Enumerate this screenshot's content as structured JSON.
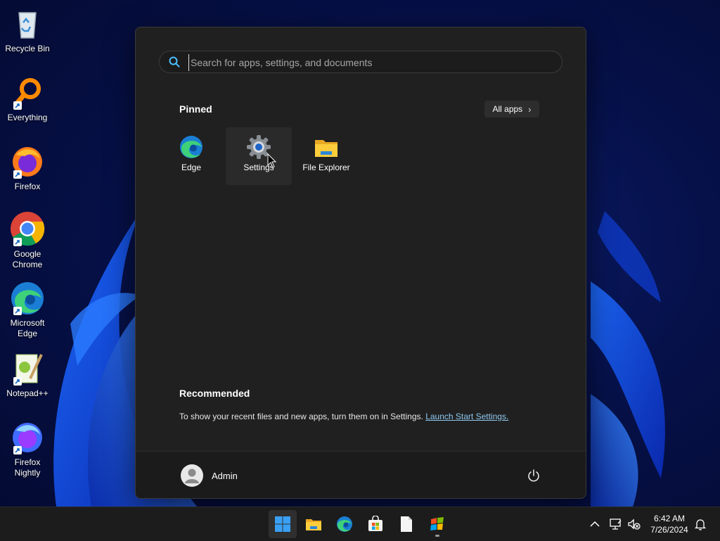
{
  "desktop": {
    "icons": [
      {
        "label": "Recycle Bin",
        "icon": "recycle-bin-icon"
      },
      {
        "label": "Everything",
        "icon": "everything-icon"
      },
      {
        "label": "Firefox",
        "icon": "firefox-icon"
      },
      {
        "label": "Google Chrome",
        "icon": "chrome-icon"
      },
      {
        "label": "Microsoft Edge",
        "icon": "edge-icon"
      },
      {
        "label": "Notepad++",
        "icon": "notepadpp-icon"
      },
      {
        "label": "Firefox Nightly",
        "icon": "firefox-nightly-icon"
      }
    ]
  },
  "start_menu": {
    "search": {
      "placeholder": "Search for apps, settings, and documents",
      "value": ""
    },
    "pinned": {
      "title": "Pinned",
      "all_apps_label": "All apps",
      "apps": [
        {
          "label": "Edge",
          "icon": "edge-icon"
        },
        {
          "label": "Settings",
          "icon": "settings-gear-icon"
        },
        {
          "label": "File Explorer",
          "icon": "folder-icon"
        }
      ]
    },
    "recommended": {
      "title": "Recommended",
      "text": "To show your recent files and new apps, turn them on in Settings.",
      "link": "Launch Start Settings."
    },
    "user": {
      "name": "Admin"
    }
  },
  "taskbar": {
    "apps": [
      "start-icon",
      "file-explorer-icon",
      "edge-icon",
      "store-icon",
      "notepad-icon",
      "winrar-icon"
    ],
    "clock": {
      "time": "6:42 AM",
      "date": "7/26/2024"
    }
  },
  "colors": {
    "accent": "#0078d4",
    "link": "#8fc8f0",
    "start_bg": "#202020",
    "taskbar_bg": "#1c1c1c"
  }
}
